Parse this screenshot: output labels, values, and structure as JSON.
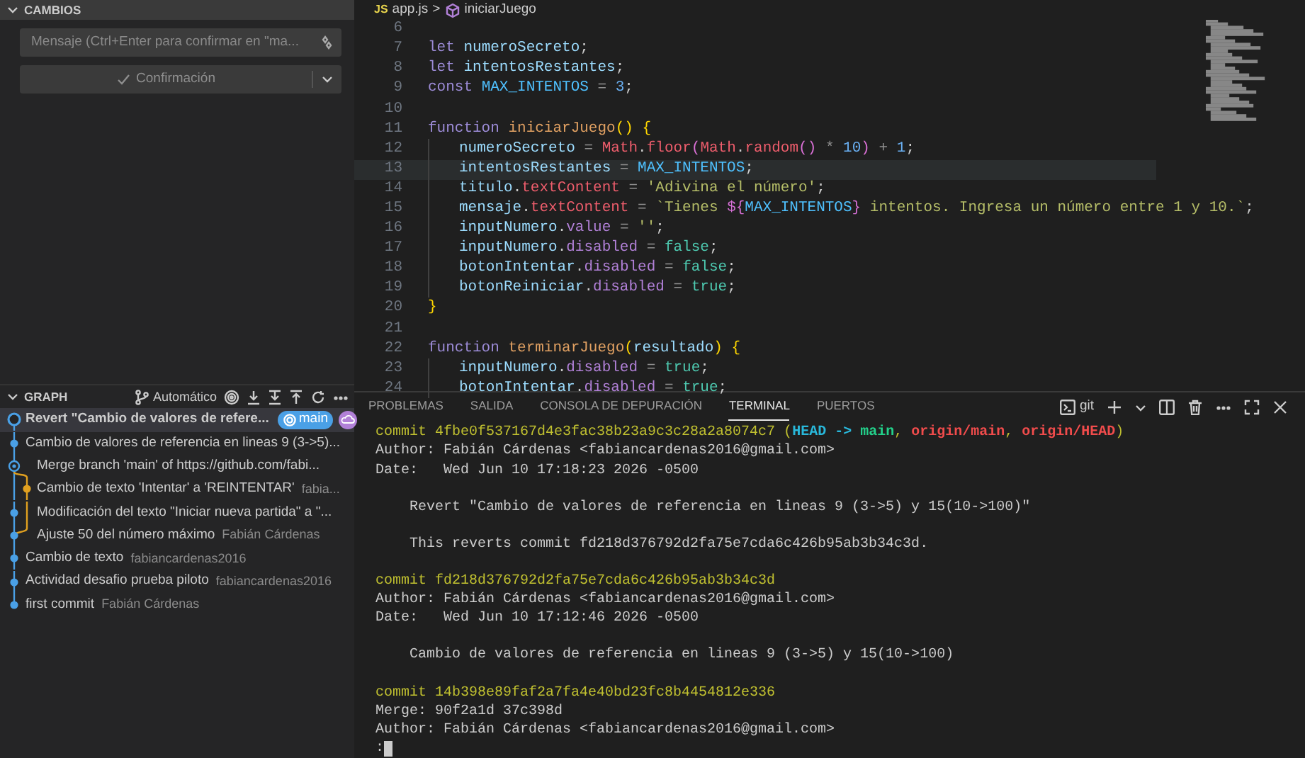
{
  "changes": {
    "title": "CAMBIOS",
    "message": {
      "placeholder": "Mensaje (Ctrl+Enter para confirmar en \"ma..."
    },
    "commit_button": "Confirmación"
  },
  "graph": {
    "title": "GRAPH",
    "mode": "Automático",
    "rows": [
      {
        "kind": "head",
        "message": "Revert \"Cambio de valores de refere...",
        "bold": true,
        "selected": true,
        "branch": "main"
      },
      {
        "kind": "commit",
        "message": "Cambio de valores de referencia en lineas 9 (3->5)...",
        "bold": false,
        "selected": false
      },
      {
        "kind": "merge",
        "message": "Merge branch 'main' of https://github.com/fabi...",
        "bold": false,
        "selected": false
      },
      {
        "kind": "branch",
        "message": "Cambio de texto 'Intentar' a 'REINTENTAR'",
        "author": "fabia...",
        "bold": false,
        "selected": false
      },
      {
        "kind": "side",
        "message": "Modificación del texto \"Iniciar nueva partida\" a \"...",
        "bold": false,
        "selected": false
      },
      {
        "kind": "join",
        "message": "Ajuste 50 del número máximo",
        "author": "Fabián Cárdenas",
        "bold": false,
        "selected": false
      },
      {
        "kind": "commit",
        "message": "Cambio de texto",
        "author": "fabiancardenas2016",
        "bold": false,
        "selected": false
      },
      {
        "kind": "commit",
        "message": "Actividad desafio prueba piloto",
        "author": "fabiancardenas2016",
        "bold": false,
        "selected": false
      },
      {
        "kind": "tail",
        "message": "first commit",
        "author": "Fabián Cárdenas",
        "bold": false,
        "selected": false
      }
    ]
  },
  "editor": {
    "breadcrumb": {
      "file_badge": "JS",
      "file": "app.js",
      "separator": ">",
      "symbol": "iniciarJuego"
    },
    "lines": [
      {
        "number": "6",
        "indent": false,
        "highlighted": false
      },
      {
        "number": "7",
        "indent": false,
        "highlighted": false,
        "tokens": [
          {
            "kind": "kw",
            "text": "let "
          },
          {
            "kind": "var",
            "text": "numeroSecreto"
          },
          {
            "kind": "punc",
            "text": ";"
          }
        ]
      },
      {
        "number": "8",
        "indent": false,
        "highlighted": false,
        "tokens": [
          {
            "kind": "kw",
            "text": "let "
          },
          {
            "kind": "var",
            "text": "intentosRestantes"
          },
          {
            "kind": "punc",
            "text": ";"
          }
        ]
      },
      {
        "number": "9",
        "indent": false,
        "highlighted": false,
        "tokens": [
          {
            "kind": "kw",
            "text": "const "
          },
          {
            "kind": "const",
            "text": "MAX_INTENTOS"
          },
          {
            "kind": "op",
            "text": " = "
          },
          {
            "kind": "num",
            "text": "3"
          },
          {
            "kind": "punc",
            "text": ";"
          }
        ]
      },
      {
        "number": "10",
        "indent": false,
        "highlighted": false
      },
      {
        "number": "11",
        "indent": false,
        "highlighted": false,
        "tokens": [
          {
            "kind": "kw",
            "text": "function "
          },
          {
            "kind": "fn",
            "text": "iniciarJuego"
          },
          {
            "kind": "brace",
            "text": "() {"
          }
        ]
      },
      {
        "number": "12",
        "indent": true,
        "highlighted": false,
        "tokens": [
          {
            "kind": "var",
            "text": "numeroSecreto"
          },
          {
            "kind": "op",
            "text": " = "
          },
          {
            "kind": "obj",
            "text": "Math"
          },
          {
            "kind": "punc",
            "text": "."
          },
          {
            "kind": "obj",
            "text": "floor"
          },
          {
            "kind": "paren",
            "text": "("
          },
          {
            "kind": "obj",
            "text": "Math"
          },
          {
            "kind": "punc",
            "text": "."
          },
          {
            "kind": "obj",
            "text": "random"
          },
          {
            "kind": "paren",
            "text": "()"
          },
          {
            "kind": "op",
            "text": " * "
          },
          {
            "kind": "num",
            "text": "10"
          },
          {
            "kind": "paren",
            "text": ")"
          },
          {
            "kind": "op",
            "text": " + "
          },
          {
            "kind": "num",
            "text": "1"
          },
          {
            "kind": "punc",
            "text": ";"
          }
        ]
      },
      {
        "number": "13",
        "indent": true,
        "highlighted": true,
        "tokens": [
          {
            "kind": "var",
            "text": "intentosRestantes"
          },
          {
            "kind": "op",
            "text": " = "
          },
          {
            "kind": "const",
            "text": "MAX_INTENTOS"
          },
          {
            "kind": "punc",
            "text": ";"
          }
        ]
      },
      {
        "number": "14",
        "indent": true,
        "highlighted": false,
        "tokens": [
          {
            "kind": "var",
            "text": "titulo"
          },
          {
            "kind": "punc",
            "text": "."
          },
          {
            "kind": "prop",
            "text": "textContent"
          },
          {
            "kind": "op",
            "text": " = "
          },
          {
            "kind": "str",
            "text": "'Adivina el número'"
          },
          {
            "kind": "punc",
            "text": ";"
          }
        ]
      },
      {
        "number": "15",
        "indent": true,
        "highlighted": false,
        "tokens": [
          {
            "kind": "var",
            "text": "mensaje"
          },
          {
            "kind": "punc",
            "text": "."
          },
          {
            "kind": "prop",
            "text": "textContent"
          },
          {
            "kind": "op",
            "text": " = "
          },
          {
            "kind": "str",
            "text": "`Tienes "
          },
          {
            "kind": "interp",
            "text": "${"
          },
          {
            "kind": "const",
            "text": "MAX_INTENTOS"
          },
          {
            "kind": "interp",
            "text": "}"
          },
          {
            "kind": "str",
            "text": " intentos. Ingresa un número entre 1 y 10.`"
          },
          {
            "kind": "punc",
            "text": ";"
          }
        ]
      },
      {
        "number": "16",
        "indent": true,
        "highlighted": false,
        "tokens": [
          {
            "kind": "var",
            "text": "inputNumero"
          },
          {
            "kind": "punc",
            "text": "."
          },
          {
            "kind": "field",
            "text": "value"
          },
          {
            "kind": "op",
            "text": " = "
          },
          {
            "kind": "str",
            "text": "''"
          },
          {
            "kind": "punc",
            "text": ";"
          }
        ]
      },
      {
        "number": "17",
        "indent": true,
        "highlighted": false,
        "tokens": [
          {
            "kind": "var",
            "text": "inputNumero"
          },
          {
            "kind": "punc",
            "text": "."
          },
          {
            "kind": "field",
            "text": "disabled"
          },
          {
            "kind": "op",
            "text": " = "
          },
          {
            "kind": "bool",
            "text": "false"
          },
          {
            "kind": "punc",
            "text": ";"
          }
        ]
      },
      {
        "number": "18",
        "indent": true,
        "highlighted": false,
        "tokens": [
          {
            "kind": "var",
            "text": "botonIntentar"
          },
          {
            "kind": "punc",
            "text": "."
          },
          {
            "kind": "field",
            "text": "disabled"
          },
          {
            "kind": "op",
            "text": " = "
          },
          {
            "kind": "bool",
            "text": "false"
          },
          {
            "kind": "punc",
            "text": ";"
          }
        ]
      },
      {
        "number": "19",
        "indent": true,
        "highlighted": false,
        "tokens": [
          {
            "kind": "var",
            "text": "botonReiniciar"
          },
          {
            "kind": "punc",
            "text": "."
          },
          {
            "kind": "field",
            "text": "disabled"
          },
          {
            "kind": "op",
            "text": " = "
          },
          {
            "kind": "bool",
            "text": "true"
          },
          {
            "kind": "punc",
            "text": ";"
          }
        ]
      },
      {
        "number": "20",
        "indent": false,
        "highlighted": false,
        "tokens": [
          {
            "kind": "brace",
            "text": "}"
          }
        ]
      },
      {
        "number": "21",
        "indent": false,
        "highlighted": false
      },
      {
        "number": "22",
        "indent": false,
        "highlighted": false,
        "tokens": [
          {
            "kind": "kw",
            "text": "function "
          },
          {
            "kind": "fn",
            "text": "terminarJuego"
          },
          {
            "kind": "brace",
            "text": "("
          },
          {
            "kind": "var",
            "text": "resultado"
          },
          {
            "kind": "brace",
            "text": ") {"
          }
        ]
      },
      {
        "number": "23",
        "indent": true,
        "highlighted": false,
        "tokens": [
          {
            "kind": "var",
            "text": "inputNumero"
          },
          {
            "kind": "punc",
            "text": "."
          },
          {
            "kind": "field",
            "text": "disabled"
          },
          {
            "kind": "op",
            "text": " = "
          },
          {
            "kind": "bool",
            "text": "true"
          },
          {
            "kind": "punc",
            "text": ";"
          }
        ]
      },
      {
        "number": "24",
        "indent": true,
        "highlighted": false,
        "tokens": [
          {
            "kind": "var",
            "text": "botonIntentar"
          },
          {
            "kind": "punc",
            "text": "."
          },
          {
            "kind": "field",
            "text": "disabled"
          },
          {
            "kind": "op",
            "text": " = "
          },
          {
            "kind": "bool",
            "text": "true"
          },
          {
            "kind": "punc",
            "text": ";"
          }
        ]
      }
    ]
  },
  "panel": {
    "tabs": [
      {
        "label": "PROBLEMAS",
        "selected": false
      },
      {
        "label": "SALIDA",
        "selected": false
      },
      {
        "label": "CONSOLA DE DEPURACIÓN",
        "selected": false
      },
      {
        "label": "TERMINAL",
        "selected": true
      },
      {
        "label": "PUERTOS",
        "selected": false
      }
    ],
    "terminal_name": "git",
    "lines": [
      {
        "kind": "text",
        "tokens": [
          {
            "kind": "hash",
            "text": "commit 4fbe0f537167d4e3fac38b23a9c3c28a2a8074c7 ("
          },
          {
            "kind": "head",
            "text": "HEAD -> "
          },
          {
            "kind": "local",
            "text": "main"
          },
          {
            "kind": "hash",
            "text": ", "
          },
          {
            "kind": "remote",
            "text": "origin/main"
          },
          {
            "kind": "hash",
            "text": ", "
          },
          {
            "kind": "remote",
            "text": "origin/HEAD"
          },
          {
            "kind": "hash",
            "text": ")"
          }
        ]
      },
      {
        "kind": "text",
        "tokens": [
          {
            "kind": "plain",
            "text": "Author: Fabián Cárdenas <fabiancardenas2016@gmail.com>"
          }
        ]
      },
      {
        "kind": "text",
        "tokens": [
          {
            "kind": "plain",
            "text": "Date:   Wed Jun 10 17:18:23 2026 -0500"
          }
        ]
      },
      {
        "kind": "blank"
      },
      {
        "kind": "text",
        "tokens": [
          {
            "kind": "plain",
            "text": "    Revert \"Cambio de valores de referencia en lineas 9 (3->5) y 15(10->100)\""
          }
        ]
      },
      {
        "kind": "blank"
      },
      {
        "kind": "text",
        "tokens": [
          {
            "kind": "plain",
            "text": "    This reverts commit fd218d376792d2fa75e7cda6c426b95ab3b34c3d."
          }
        ]
      },
      {
        "kind": "blank"
      },
      {
        "kind": "text",
        "tokens": [
          {
            "kind": "hash",
            "text": "commit fd218d376792d2fa75e7cda6c426b95ab3b34c3d"
          }
        ]
      },
      {
        "kind": "text",
        "tokens": [
          {
            "kind": "plain",
            "text": "Author: Fabián Cárdenas <fabiancardenas2016@gmail.com>"
          }
        ]
      },
      {
        "kind": "text",
        "tokens": [
          {
            "kind": "plain",
            "text": "Date:   Wed Jun 10 17:12:46 2026 -0500"
          }
        ]
      },
      {
        "kind": "blank"
      },
      {
        "kind": "text",
        "tokens": [
          {
            "kind": "plain",
            "text": "    Cambio de valores de referencia en lineas 9 (3->5) y 15(10->100)"
          }
        ]
      },
      {
        "kind": "blank"
      },
      {
        "kind": "text",
        "tokens": [
          {
            "kind": "hash",
            "text": "commit 14b398e89faf2a7fa4e40bd23fc8b4454812e336"
          }
        ]
      },
      {
        "kind": "text",
        "tokens": [
          {
            "kind": "plain",
            "text": "Merge: 90f2a1d 37c398d"
          }
        ]
      },
      {
        "kind": "text",
        "tokens": [
          {
            "kind": "plain",
            "text": "Author: Fabián Cárdenas <fabiancardenas2016@gmail.com>"
          }
        ]
      },
      {
        "kind": "prompt",
        "tokens": [
          {
            "kind": "plain",
            "text": ":"
          }
        ]
      }
    ]
  }
}
